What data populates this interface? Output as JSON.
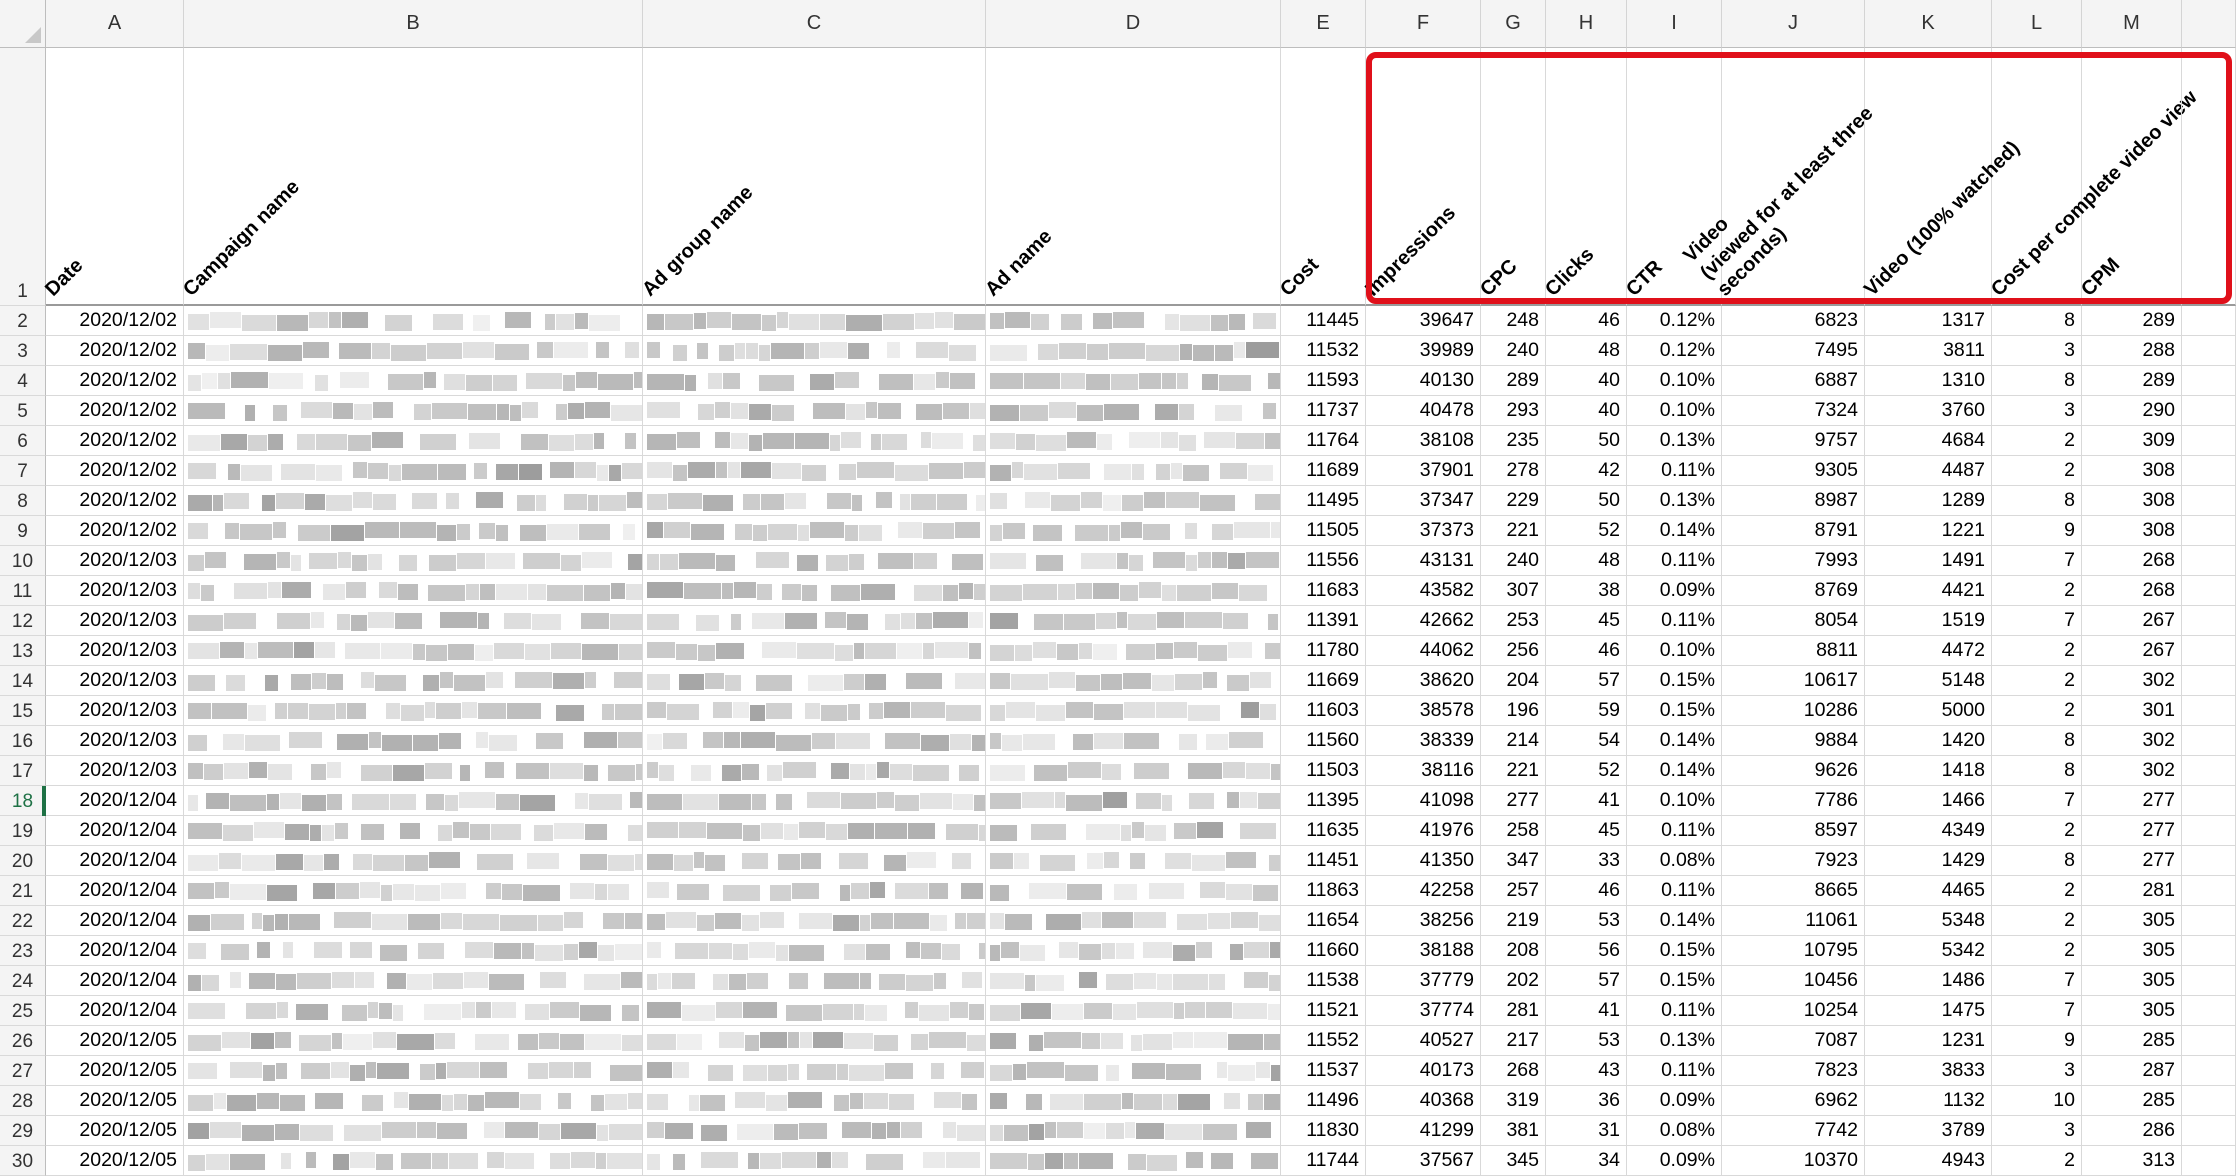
{
  "columns": [
    "A",
    "B",
    "C",
    "D",
    "E",
    "F",
    "G",
    "H",
    "I",
    "J",
    "K",
    "L",
    "M"
  ],
  "header_row_number": "1",
  "headers": {
    "A": "Date",
    "B": "Campaign name",
    "C": "Ad group name",
    "D": "Ad name",
    "E": "Cost",
    "F": "Impressions",
    "G": "CPC",
    "H": "Clicks",
    "I": "CTR",
    "J": "Video\n(viewed for at least three\nseconds)",
    "K": "Video (100% watched)",
    "L": "Cost per complete video view",
    "M": "CPM"
  },
  "selected_row": "18",
  "highlight_color": "#e0101a",
  "rows": [
    {
      "row": "2",
      "date": "2020/12/02",
      "cost": "11445",
      "impressions": "39647",
      "cpc": "248",
      "clicks": "46",
      "ctr": "0.12%",
      "video3s": "6823",
      "video100": "1317",
      "cpcv": "8",
      "cpm": "289"
    },
    {
      "row": "3",
      "date": "2020/12/02",
      "cost": "11532",
      "impressions": "39989",
      "cpc": "240",
      "clicks": "48",
      "ctr": "0.12%",
      "video3s": "7495",
      "video100": "3811",
      "cpcv": "3",
      "cpm": "288"
    },
    {
      "row": "4",
      "date": "2020/12/02",
      "cost": "11593",
      "impressions": "40130",
      "cpc": "289",
      "clicks": "40",
      "ctr": "0.10%",
      "video3s": "6887",
      "video100": "1310",
      "cpcv": "8",
      "cpm": "289"
    },
    {
      "row": "5",
      "date": "2020/12/02",
      "cost": "11737",
      "impressions": "40478",
      "cpc": "293",
      "clicks": "40",
      "ctr": "0.10%",
      "video3s": "7324",
      "video100": "3760",
      "cpcv": "3",
      "cpm": "290"
    },
    {
      "row": "6",
      "date": "2020/12/02",
      "cost": "11764",
      "impressions": "38108",
      "cpc": "235",
      "clicks": "50",
      "ctr": "0.13%",
      "video3s": "9757",
      "video100": "4684",
      "cpcv": "2",
      "cpm": "309"
    },
    {
      "row": "7",
      "date": "2020/12/02",
      "cost": "11689",
      "impressions": "37901",
      "cpc": "278",
      "clicks": "42",
      "ctr": "0.11%",
      "video3s": "9305",
      "video100": "4487",
      "cpcv": "2",
      "cpm": "308"
    },
    {
      "row": "8",
      "date": "2020/12/02",
      "cost": "11495",
      "impressions": "37347",
      "cpc": "229",
      "clicks": "50",
      "ctr": "0.13%",
      "video3s": "8987",
      "video100": "1289",
      "cpcv": "8",
      "cpm": "308"
    },
    {
      "row": "9",
      "date": "2020/12/02",
      "cost": "11505",
      "impressions": "37373",
      "cpc": "221",
      "clicks": "52",
      "ctr": "0.14%",
      "video3s": "8791",
      "video100": "1221",
      "cpcv": "9",
      "cpm": "308"
    },
    {
      "row": "10",
      "date": "2020/12/03",
      "cost": "11556",
      "impressions": "43131",
      "cpc": "240",
      "clicks": "48",
      "ctr": "0.11%",
      "video3s": "7993",
      "video100": "1491",
      "cpcv": "7",
      "cpm": "268"
    },
    {
      "row": "11",
      "date": "2020/12/03",
      "cost": "11683",
      "impressions": "43582",
      "cpc": "307",
      "clicks": "38",
      "ctr": "0.09%",
      "video3s": "8769",
      "video100": "4421",
      "cpcv": "2",
      "cpm": "268"
    },
    {
      "row": "12",
      "date": "2020/12/03",
      "cost": "11391",
      "impressions": "42662",
      "cpc": "253",
      "clicks": "45",
      "ctr": "0.11%",
      "video3s": "8054",
      "video100": "1519",
      "cpcv": "7",
      "cpm": "267"
    },
    {
      "row": "13",
      "date": "2020/12/03",
      "cost": "11780",
      "impressions": "44062",
      "cpc": "256",
      "clicks": "46",
      "ctr": "0.10%",
      "video3s": "8811",
      "video100": "4472",
      "cpcv": "2",
      "cpm": "267"
    },
    {
      "row": "14",
      "date": "2020/12/03",
      "cost": "11669",
      "impressions": "38620",
      "cpc": "204",
      "clicks": "57",
      "ctr": "0.15%",
      "video3s": "10617",
      "video100": "5148",
      "cpcv": "2",
      "cpm": "302"
    },
    {
      "row": "15",
      "date": "2020/12/03",
      "cost": "11603",
      "impressions": "38578",
      "cpc": "196",
      "clicks": "59",
      "ctr": "0.15%",
      "video3s": "10286",
      "video100": "5000",
      "cpcv": "2",
      "cpm": "301"
    },
    {
      "row": "16",
      "date": "2020/12/03",
      "cost": "11560",
      "impressions": "38339",
      "cpc": "214",
      "clicks": "54",
      "ctr": "0.14%",
      "video3s": "9884",
      "video100": "1420",
      "cpcv": "8",
      "cpm": "302"
    },
    {
      "row": "17",
      "date": "2020/12/03",
      "cost": "11503",
      "impressions": "38116",
      "cpc": "221",
      "clicks": "52",
      "ctr": "0.14%",
      "video3s": "9626",
      "video100": "1418",
      "cpcv": "8",
      "cpm": "302"
    },
    {
      "row": "18",
      "date": "2020/12/04",
      "cost": "11395",
      "impressions": "41098",
      "cpc": "277",
      "clicks": "41",
      "ctr": "0.10%",
      "video3s": "7786",
      "video100": "1466",
      "cpcv": "7",
      "cpm": "277"
    },
    {
      "row": "19",
      "date": "2020/12/04",
      "cost": "11635",
      "impressions": "41976",
      "cpc": "258",
      "clicks": "45",
      "ctr": "0.11%",
      "video3s": "8597",
      "video100": "4349",
      "cpcv": "2",
      "cpm": "277"
    },
    {
      "row": "20",
      "date": "2020/12/04",
      "cost": "11451",
      "impressions": "41350",
      "cpc": "347",
      "clicks": "33",
      "ctr": "0.08%",
      "video3s": "7923",
      "video100": "1429",
      "cpcv": "8",
      "cpm": "277"
    },
    {
      "row": "21",
      "date": "2020/12/04",
      "cost": "11863",
      "impressions": "42258",
      "cpc": "257",
      "clicks": "46",
      "ctr": "0.11%",
      "video3s": "8665",
      "video100": "4465",
      "cpcv": "2",
      "cpm": "281"
    },
    {
      "row": "22",
      "date": "2020/12/04",
      "cost": "11654",
      "impressions": "38256",
      "cpc": "219",
      "clicks": "53",
      "ctr": "0.14%",
      "video3s": "11061",
      "video100": "5348",
      "cpcv": "2",
      "cpm": "305"
    },
    {
      "row": "23",
      "date": "2020/12/04",
      "cost": "11660",
      "impressions": "38188",
      "cpc": "208",
      "clicks": "56",
      "ctr": "0.15%",
      "video3s": "10795",
      "video100": "5342",
      "cpcv": "2",
      "cpm": "305"
    },
    {
      "row": "24",
      "date": "2020/12/04",
      "cost": "11538",
      "impressions": "37779",
      "cpc": "202",
      "clicks": "57",
      "ctr": "0.15%",
      "video3s": "10456",
      "video100": "1486",
      "cpcv": "7",
      "cpm": "305"
    },
    {
      "row": "25",
      "date": "2020/12/04",
      "cost": "11521",
      "impressions": "37774",
      "cpc": "281",
      "clicks": "41",
      "ctr": "0.11%",
      "video3s": "10254",
      "video100": "1475",
      "cpcv": "7",
      "cpm": "305"
    },
    {
      "row": "26",
      "date": "2020/12/05",
      "cost": "11552",
      "impressions": "40527",
      "cpc": "217",
      "clicks": "53",
      "ctr": "0.13%",
      "video3s": "7087",
      "video100": "1231",
      "cpcv": "9",
      "cpm": "285"
    },
    {
      "row": "27",
      "date": "2020/12/05",
      "cost": "11537",
      "impressions": "40173",
      "cpc": "268",
      "clicks": "43",
      "ctr": "0.11%",
      "video3s": "7823",
      "video100": "3833",
      "cpcv": "3",
      "cpm": "287"
    },
    {
      "row": "28",
      "date": "2020/12/05",
      "cost": "11496",
      "impressions": "40368",
      "cpc": "319",
      "clicks": "36",
      "ctr": "0.09%",
      "video3s": "6962",
      "video100": "1132",
      "cpcv": "10",
      "cpm": "285"
    },
    {
      "row": "29",
      "date": "2020/12/05",
      "cost": "11830",
      "impressions": "41299",
      "cpc": "381",
      "clicks": "31",
      "ctr": "0.08%",
      "video3s": "7742",
      "video100": "3789",
      "cpcv": "3",
      "cpm": "286"
    },
    {
      "row": "30",
      "date": "2020/12/05",
      "cost": "11744",
      "impressions": "37567",
      "cpc": "345",
      "clicks": "34",
      "ctr": "0.09%",
      "video3s": "10370",
      "video100": "4943",
      "cpcv": "2",
      "cpm": "313"
    }
  ]
}
